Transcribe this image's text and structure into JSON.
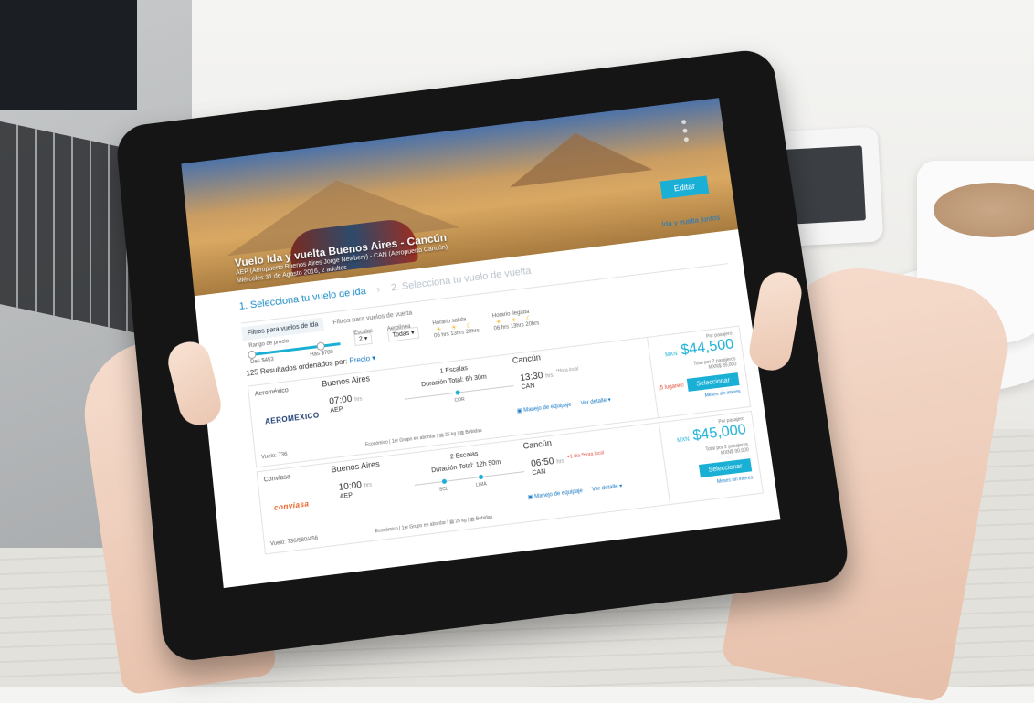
{
  "hero": {
    "title": "Vuelo Ida y vuelta Buenos Aires - Cancún",
    "route": "AEP (Aeropuerto Buenos Aires Jorge Newbery) - CAN (Aeropuerto Cancún)",
    "date": "Miércoles 31 de Agosto 2016, 2 adultos",
    "edit_label": "Editar",
    "roundtrip_link": "Ida y vuelta juntos"
  },
  "steps": [
    {
      "label": "1. Selecciona tu vuelo de ida",
      "active": true
    },
    {
      "label": "2. Selecciona tu vuelo de vuelta",
      "active": false
    }
  ],
  "filters": {
    "tabs": [
      "Filtros para vuelos de ida",
      "Filtros para vuelos de vuelta"
    ],
    "price_range_label": "Rango de precio",
    "price_min": "Des $453",
    "price_max": "Has $780",
    "escalas_label": "Escalas",
    "escalas_value": "2",
    "aerolinea_label": "Aerolínea",
    "aerolinea_value": "Todas",
    "salida_label": "Horario salida",
    "llegada_label": "Horario llegada",
    "time_slots": [
      "06 hrs",
      "13hrs",
      "20hrs"
    ]
  },
  "results": {
    "count_text": "125 Resultados ordenados por:",
    "order_value": "Precio"
  },
  "flights": [
    {
      "airline": "Aeroméxico",
      "logo_text": "AEROMEXICO",
      "logo_color": "#1d3b73",
      "flight_num": "Vuelo: 736",
      "origin_city": "Buenos Aires",
      "origin_time": "07:00",
      "origin_code": "AEP",
      "dest_city": "Cancún",
      "dest_time": "13:30",
      "dest_code": "CAN",
      "escalas": "1 Escalas",
      "duracion": "Duración Total: 6h 30m",
      "stop_codes": [
        "COR"
      ],
      "note": "*Hora local",
      "cabin": "Económico",
      "boarding": "1er Grupo en abordar",
      "bag": "25 kg",
      "drinks": "Bebidas",
      "equip_link": "Manejo de equipaje",
      "detail_link": "Ver detalle",
      "price_per": "Por pasajero",
      "currency": "MXN",
      "price": "$44,500",
      "total_label": "Total por 2 pasajeros",
      "total_value": "MXN$ 89,000",
      "seats_left": "¡5 lugares!",
      "select_label": "Seleccionar",
      "months_label": "Meses sin interes"
    },
    {
      "airline": "Conviasa",
      "logo_text": "conviasa",
      "logo_color": "#e65b1e",
      "flight_num": "Vuelo: 736/580/456",
      "origin_city": "Buenos Aires",
      "origin_time": "10:00",
      "origin_code": "AEP",
      "dest_city": "Cancún",
      "dest_time": "06:50",
      "dest_code": "CAN",
      "escalas": "2 Escalas",
      "duracion": "Duración Total: 12h 50m",
      "stop_codes": [
        "SCL",
        "LIMA"
      ],
      "note": "+1 día *Hora local",
      "cabin": "Económico",
      "boarding": "1er Grupo en abordar",
      "bag": "25 kg",
      "drinks": "Bebidas",
      "equip_link": "Manejo de equipaje",
      "detail_link": "Ver detalle",
      "price_per": "Por pasajero",
      "currency": "MXN",
      "price": "$45,000",
      "total_label": "Total por 2 pasajeros",
      "total_value": "MXN$ 90,000",
      "seats_left": "",
      "select_label": "Seleccionar",
      "months_label": "Meses sin interes"
    }
  ],
  "colors": {
    "accent": "#1ab0d6",
    "link": "#1a7ac4",
    "warning": "#e24a3b"
  }
}
